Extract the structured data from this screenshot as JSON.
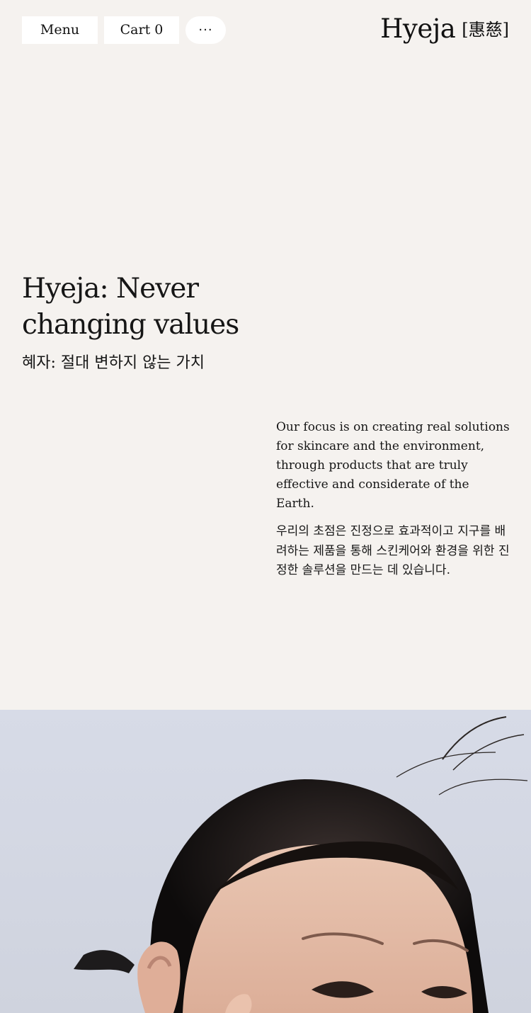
{
  "header": {
    "menu_label": "Menu",
    "cart_label": "Cart 0",
    "more_label": "···",
    "brand_name": "Hyeja",
    "brand_hanja": "[惠慈]"
  },
  "hero": {
    "title": "Hyeja: Never changing values",
    "title_korean": "혜자: 절대 변하지 않는 가치"
  },
  "mission": {
    "english": "Our focus is on creating real solutions for skincare and the environment, through products that are truly effective and considerate of the Earth.",
    "korean": "우리의 초점은 진정으로 효과적이고 지구를 배려하는 제품을 통해 스킨케어와 환경을 위한 진정한 솔루션을 만드는 데 있습니다."
  },
  "colors": {
    "background": "#f5f2ef",
    "text": "#161616",
    "button": "#ffffff"
  },
  "icons": {
    "more": "more-dots-icon",
    "photo": "model-portrait-photo"
  }
}
